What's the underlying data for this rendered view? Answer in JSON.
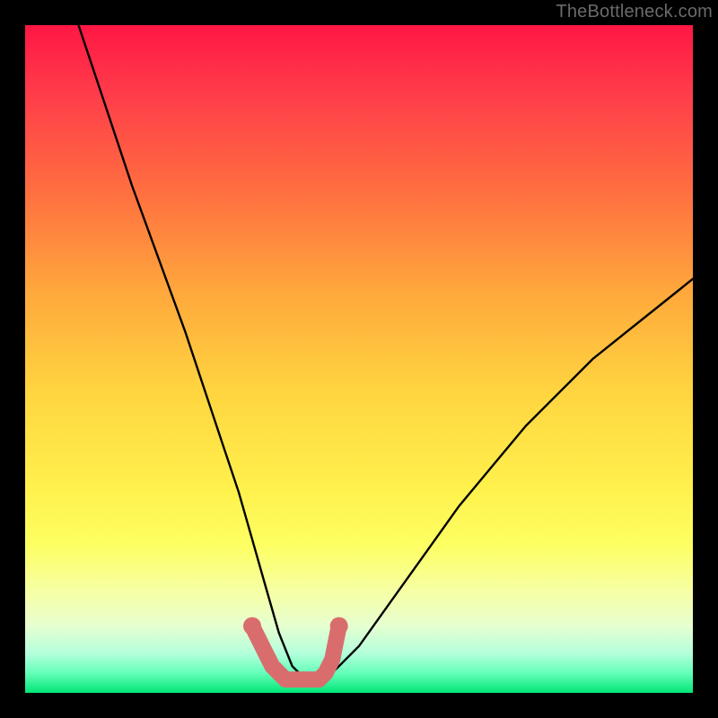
{
  "watermark": "TheBottleneck.com",
  "chart_data": {
    "type": "line",
    "title": "",
    "xlabel": "",
    "ylabel": "",
    "xlim": [
      0,
      100
    ],
    "ylim": [
      0,
      100
    ],
    "series": [
      {
        "name": "bottleneck-curve",
        "color": "#000000",
        "x": [
          8,
          12,
          16,
          20,
          24,
          28,
          30,
          32,
          34,
          36,
          38,
          40,
          42,
          44,
          46,
          50,
          55,
          60,
          65,
          70,
          75,
          80,
          85,
          90,
          95,
          100
        ],
        "y": [
          100,
          88,
          76,
          65,
          54,
          42,
          36,
          30,
          23,
          16,
          9,
          4,
          2,
          2,
          3,
          7,
          14,
          21,
          28,
          34,
          40,
          45,
          50,
          54,
          58,
          62
        ]
      },
      {
        "name": "optimal-marker",
        "color": "#d96d6d",
        "x": [
          34,
          35,
          36,
          37,
          38,
          39,
          40,
          41,
          42,
          43,
          44,
          45,
          46,
          47
        ],
        "y": [
          10,
          8,
          6,
          4,
          3,
          2,
          2,
          2,
          2,
          2,
          2,
          3,
          5,
          10
        ]
      }
    ]
  },
  "colors": {
    "background": "#000000",
    "curve": "#000000",
    "marker": "#d96d6d"
  }
}
